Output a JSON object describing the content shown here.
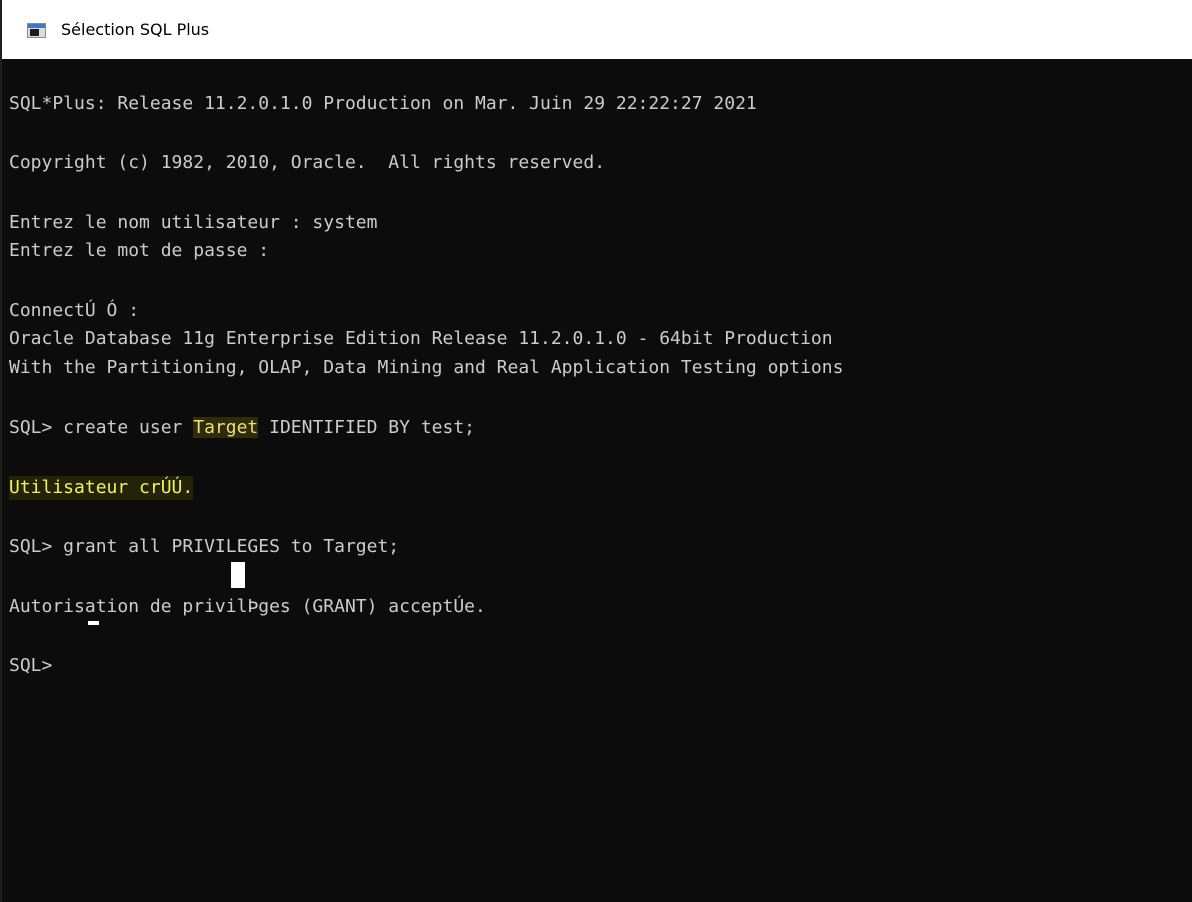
{
  "window": {
    "title": "Sélection SQL Plus"
  },
  "console": {
    "lines": [
      "SQL*Plus: Release 11.2.0.1.0 Production on Mar. Juin 29 22:22:27 2021",
      "Copyright (c) 1982, 2010, Oracle.  All rights reserved.",
      "Entrez le nom utilisateur : system",
      "Entrez le mot de passe :",
      "ConnectÚ Ó :",
      "Oracle Database 11g Enterprise Edition Release 11.2.0.1.0 - 64bit Production",
      "With the Partitioning, OLAP, Data Mining and Real Application Testing options",
      {
        "prefix": "SQL> create user ",
        "highlight": "Target",
        "suffix": " IDENTIFIED BY test;"
      },
      "Utilisateur crÚÚ.",
      "SQL> grant all PRIVILEGES to Target;",
      "Autorisation de privilÞges (GRANT) acceptÚe.",
      "SQL> "
    ]
  },
  "colors": {
    "console_background": "#0c0c0c",
    "console_text": "#cccccc",
    "highlight_text": "#f2f25a"
  }
}
